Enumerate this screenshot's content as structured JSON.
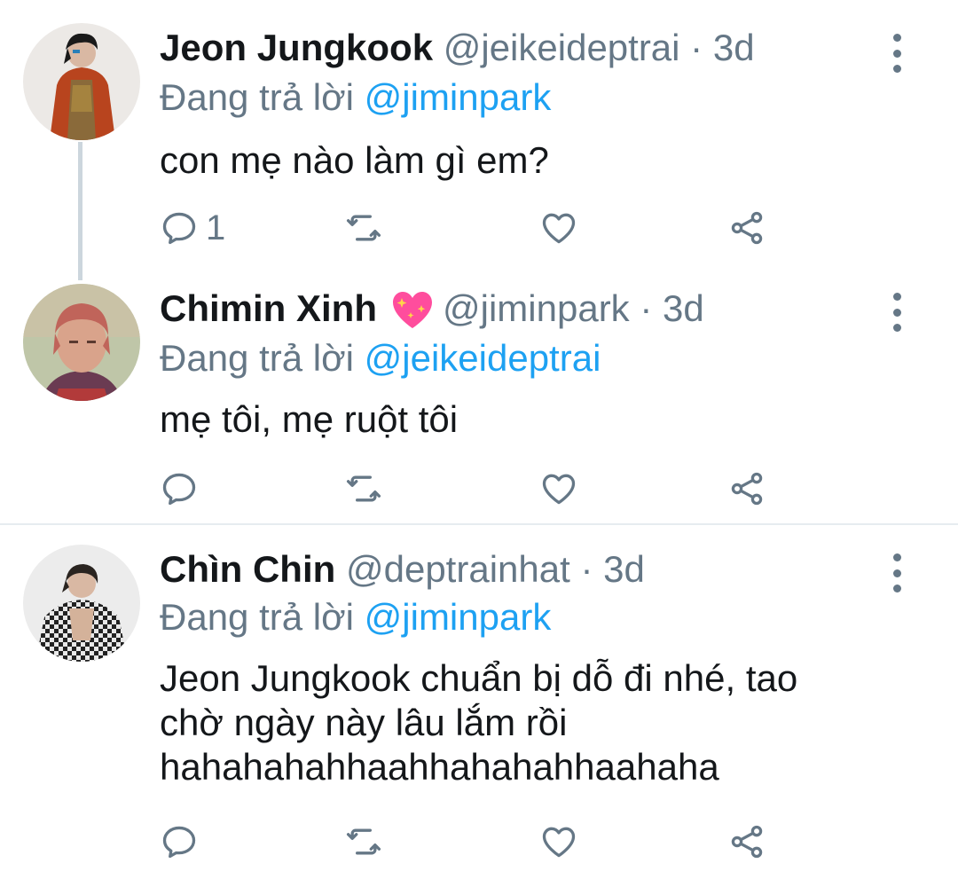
{
  "colors": {
    "accent": "#1da1f2",
    "muted": "#657786",
    "text": "#14171a",
    "divider": "#e6ecf0",
    "heart_emoji": "#ff4d9d"
  },
  "tweets": [
    {
      "name": "Jeon Jungkook",
      "handle": "@jeikeideptrai",
      "dot": "·",
      "time": "3d",
      "replying_prefix": "Đang trả lời",
      "replying_to": "@jiminpark",
      "lines": [
        "con mẹ nào làm gì em?"
      ],
      "reply_count": "1",
      "avatar_icon": "jungkook-avatar"
    },
    {
      "name": "Chimin Xinh",
      "emoji": "sparkling-heart-icon",
      "handle": "@jiminpark",
      "dot": "·",
      "time": "3d",
      "replying_prefix": "Đang trả lời",
      "replying_to": "@jeikeideptrai",
      "lines": [
        "mẹ tôi, mẹ ruột tôi"
      ],
      "reply_count": "",
      "avatar_icon": "chimin-avatar"
    },
    {
      "name": "Chìn Chin",
      "handle": "@deptrainhat",
      "dot": "·",
      "time": "3d",
      "replying_prefix": "Đang trả lời",
      "replying_to": "@jiminpark",
      "lines": [
        "Jeon Jungkook chuẩn bị dỗ đi nhé, tao",
        "chờ ngày này lâu lắm rồi",
        "hahahahahhaahhahahahhaahaha"
      ],
      "reply_count": "",
      "avatar_icon": "chin-avatar"
    }
  ]
}
